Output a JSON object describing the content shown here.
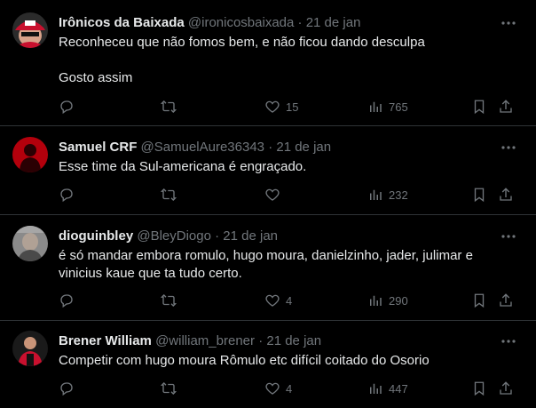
{
  "colors": {
    "background": "#000000",
    "text": "#e7e9ea",
    "muted": "#71767b",
    "divider": "#2f3336"
  },
  "tweets": [
    {
      "name": "Irônicos da Baixada",
      "handle": "@ironicosbaixada",
      "separator": "·",
      "date": "21 de jan",
      "text": "Reconheceu que não fomos bem, e não ficou dando desculpa\n\nGosto assim",
      "replies": "",
      "retweets": "",
      "likes": "15",
      "views": "765",
      "avatar_icon": "avatar-red-cap-icon"
    },
    {
      "name": "Samuel CRF",
      "handle": "@SamuelAure36343",
      "separator": "·",
      "date": "21 de jan",
      "text": "Esse time da Sul-americana é engraçado.",
      "replies": "",
      "retweets": "",
      "likes": "",
      "views": "232",
      "avatar_icon": "avatar-red-figure-icon"
    },
    {
      "name": "dioguinbley",
      "handle": "@BleyDiogo",
      "separator": "·",
      "date": "21 de jan",
      "text": "é só mandar embora romulo, hugo moura, danielzinho, jader, julimar e vinicius kaue que ta tudo certo.",
      "replies": "",
      "retweets": "",
      "likes": "4",
      "views": "290",
      "avatar_icon": "avatar-photo-icon"
    },
    {
      "name": "Brener William",
      "handle": "@william_brener",
      "separator": "·",
      "date": "21 de jan",
      "text": "Competir com hugo moura Rômulo etc difícil coitado do Osorio",
      "replies": "",
      "retweets": "",
      "likes": "4",
      "views": "447",
      "avatar_icon": "avatar-jersey-icon"
    }
  ]
}
